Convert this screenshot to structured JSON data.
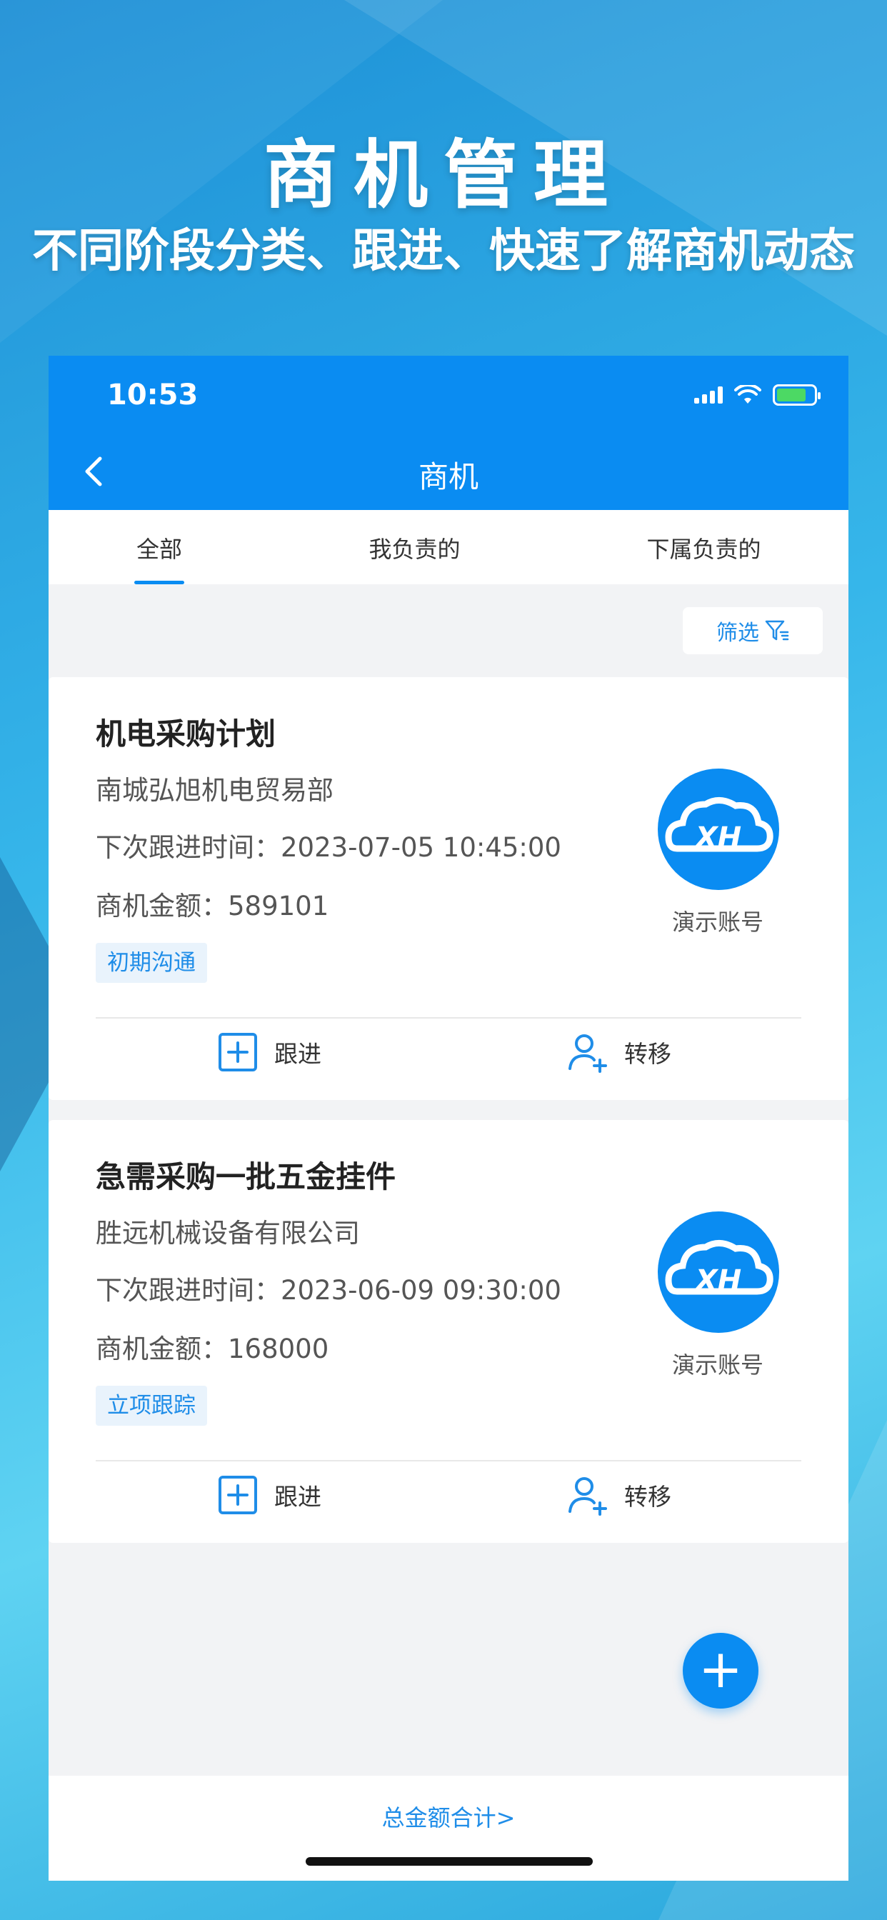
{
  "hero": {
    "title": "商机管理",
    "subtitle": "不同阶段分类、跟进、快速了解商机动态"
  },
  "status_bar": {
    "time": "10:53"
  },
  "nav": {
    "back_icon": "chevron-left-icon",
    "title": "商机"
  },
  "tabs": [
    {
      "label": "全部",
      "active": true
    },
    {
      "label": "我负责的",
      "active": false
    },
    {
      "label": "下属负责的",
      "active": false
    }
  ],
  "filter": {
    "label": "筛选",
    "icon": "filter-icon"
  },
  "cards": [
    {
      "title": "机电采购计划",
      "company": "南城弘旭机电贸易部",
      "next_follow": "下次跟进时间：2023-07-05 10:45:00",
      "amount": "商机金额：589101",
      "tag": "初期沟通",
      "owner": "演示账号",
      "action_follow": "跟进",
      "action_transfer": "转移"
    },
    {
      "title": "急需采购一批五金挂件",
      "company": "胜远机械设备有限公司",
      "next_follow": "下次跟进时间：2023-06-09 09:30:00",
      "amount": "商机金额：168000",
      "tag": "立项跟踪",
      "owner": "演示账号",
      "action_follow": "跟进",
      "action_transfer": "转移"
    }
  ],
  "fab": {
    "label": "+"
  },
  "bottom": {
    "total_link": "总金额合计>"
  },
  "colors": {
    "primary": "#0a8cf2",
    "link": "#1f8de8",
    "tag_bg": "#e9f3fc"
  },
  "avatar_logo_text": "XH"
}
